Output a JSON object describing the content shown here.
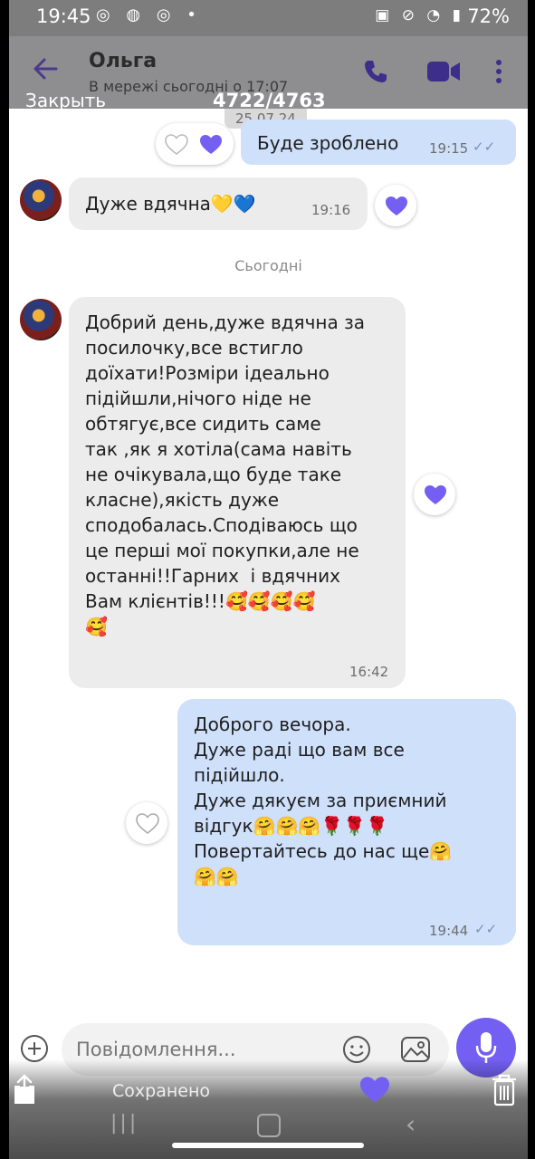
{
  "status_bar": {
    "time": "19:45",
    "left_icons": "◎ ◍ ◎ •",
    "right_icons": "▣ ⊘ ◔ ▮",
    "battery": "72%"
  },
  "header": {
    "contact_name": "Ольга",
    "contact_status": "В мережі сьогодні о 17:07"
  },
  "overlay": {
    "close_label": "Закрыть",
    "counter": "4722/4763",
    "saved_label": "Сохранено"
  },
  "chat": {
    "date_pill": "25.07.24",
    "day_label": "Сьогодні",
    "messages": [
      {
        "direction": "out",
        "text": "Буде зроблено",
        "time": "19:15"
      },
      {
        "direction": "in",
        "text": "Дуже вдячна💛💙",
        "time": "19:16"
      },
      {
        "direction": "in",
        "text": "Добрий день,дуже вдячна за\nпосилочку,все встигло\nдоїхати!Розміри ідеально\nпідійшли,нічого ніде не\nобтягує,все сидить саме\nтак ,як я хотіла(сама навіть\nне очікувала,що буде таке\nкласне),якість дуже\nсподобалась.Сподіваюсь що\nце перші мої покупки,але не\nостанні!!Гарних  і вдячних\nВам клієнтів!!!🥰🥰🥰🥰\n🥰",
        "time": "16:42"
      },
      {
        "direction": "out",
        "text": "Доброго вечора.\nДуже раді що вам все\nпідійшло.\nДуже дякуєм за приємний\nвідгук🤗🤗🤗🌹🌹🌹\nПовертайтесь до нас ще🤗\n🤗🤗",
        "time": "19:44"
      }
    ]
  },
  "input": {
    "placeholder": "Повідомлення..."
  },
  "colors": {
    "accent": "#7360f2",
    "outgoing_bubble": "#cfe0fb",
    "incoming_bubble": "#ececec"
  }
}
